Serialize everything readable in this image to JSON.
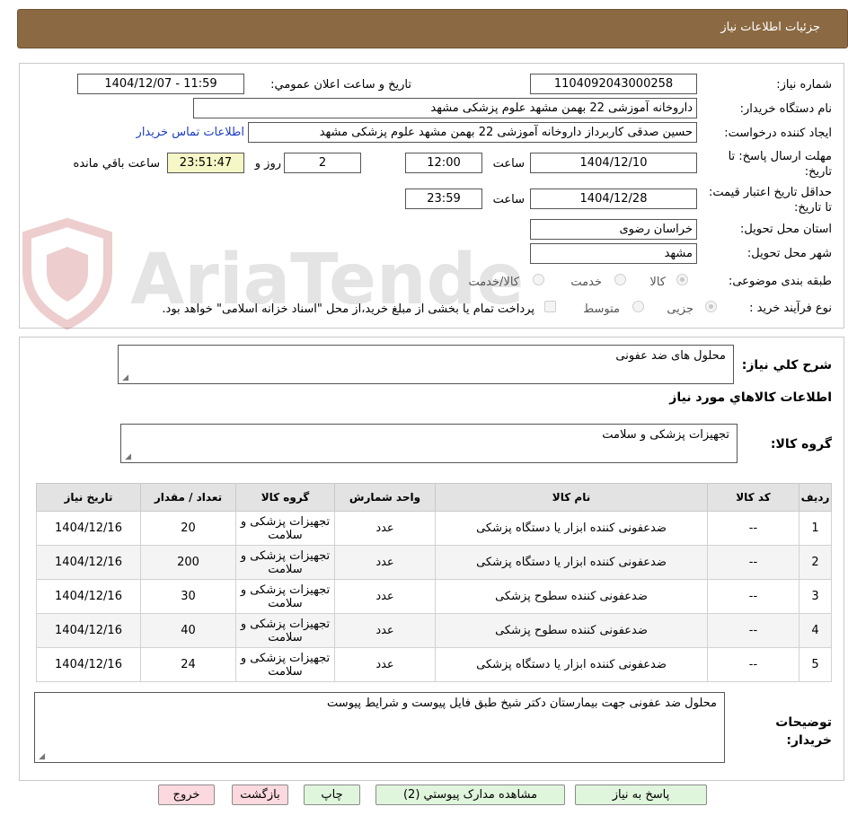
{
  "header": {
    "title": "جزئیات اطلاعات نیاز"
  },
  "form": {
    "need_number_label": "شماره نیاز:",
    "need_number": "1104092043000258",
    "announce_label": "تاریخ و ساعت اعلان عمومي:",
    "announce_value": "1404/12/07 - 11:59",
    "buyer_org_label": "نام دستگاه خریدار:",
    "buyer_org": "داروخانه آموزشی 22 بهمن مشهد   علوم پزشکی مشهد",
    "creator_label": "ایجاد کننده درخواست:",
    "creator": "حسین صدقی کاربرداز داروخانه آموزشی 22 بهمن مشهد   علوم پزشکی مشهد",
    "contact_link": "اطلاعات تماس خریدار",
    "deadline_label": "مهلت ارسال پاسخ: تا تاریخ:",
    "deadline_date": "1404/12/10",
    "time_label": "ساعت",
    "deadline_time": "12:00",
    "days_value": "2",
    "days_label": "روز و",
    "remaining_time": "23:51:47",
    "remaining_label": "ساعت باقي مانده",
    "validity_label": "حداقل تاریخ اعتبار قیمت: تا تاریخ:",
    "validity_date": "1404/12/28",
    "validity_time": "23:59",
    "province_label": "استان محل تحویل:",
    "province": "خراسان رضوی",
    "city_label": "شهر محل تحویل:",
    "city": "مشهد",
    "category_label": "طبقه بندی موضوعی:",
    "category_options": [
      "کالا",
      "خدمت",
      "کالا/خدمت"
    ],
    "process_label": "نوع فرآیند خرید :",
    "process_options": [
      "جزیی",
      "متوسط"
    ],
    "payment_note": "پرداخت تمام یا بخشی از مبلغ خرید،از محل \"اسناد خزانه اسلامی\" خواهد بود."
  },
  "watermark": {
    "text": "AriaTender.neT"
  },
  "details": {
    "summary_label": "شرح کلي نیاز:",
    "summary": "محلول های ضد عفونی",
    "goods_info_title": "اطلاعات کالاهاي مورد نیاز",
    "goods_group_label": "گروه کالا:",
    "goods_group": "تجهیزات پزشکی و سلامت",
    "table": {
      "headers": [
        "ردیف",
        "کد کالا",
        "نام کالا",
        "واحد شمارش",
        "گروه کالا",
        "تعداد / مقدار",
        "تاریخ نیاز"
      ],
      "rows": [
        [
          "1",
          "--",
          "ضدعفونی کننده ابزار یا دستگاه پزشکی",
          "عدد",
          "تجهیزات پزشکی و سلامت",
          "20",
          "1404/12/16"
        ],
        [
          "2",
          "--",
          "ضدعفونی کننده ابزار یا دستگاه پزشکی",
          "عدد",
          "تجهیزات پزشکی و سلامت",
          "200",
          "1404/12/16"
        ],
        [
          "3",
          "--",
          "ضدعفونی کننده سطوح پزشکی",
          "عدد",
          "تجهیزات پزشکی و سلامت",
          "30",
          "1404/12/16"
        ],
        [
          "4",
          "--",
          "ضدعفونی کننده سطوح پزشکی",
          "عدد",
          "تجهیزات پزشکی و سلامت",
          "40",
          "1404/12/16"
        ],
        [
          "5",
          "--",
          "ضدعفونی کننده ابزار یا دستگاه پزشکی",
          "عدد",
          "تجهیزات پزشکی و سلامت",
          "24",
          "1404/12/16"
        ]
      ]
    },
    "buyer_notes_label": "توضیحات خریدار:",
    "buyer_notes": "محلول ضد عفونی جهت بیمارستان دکتر شیخ طبق فایل پیوست و شرایط پیوست"
  },
  "buttons": {
    "reply": "پاسخ به نیاز",
    "view_docs": "مشاهده مدارک پیوستي (2)",
    "print": "چاپ",
    "back": "بازگشت",
    "exit": "خروج"
  },
  "colors": {
    "header_bg": "#8b6a43",
    "link": "#1a3cc2",
    "remaining_bg": "#f6f7c6",
    "button_green": "#dff5dc",
    "button_pink": "#fbd9de"
  }
}
